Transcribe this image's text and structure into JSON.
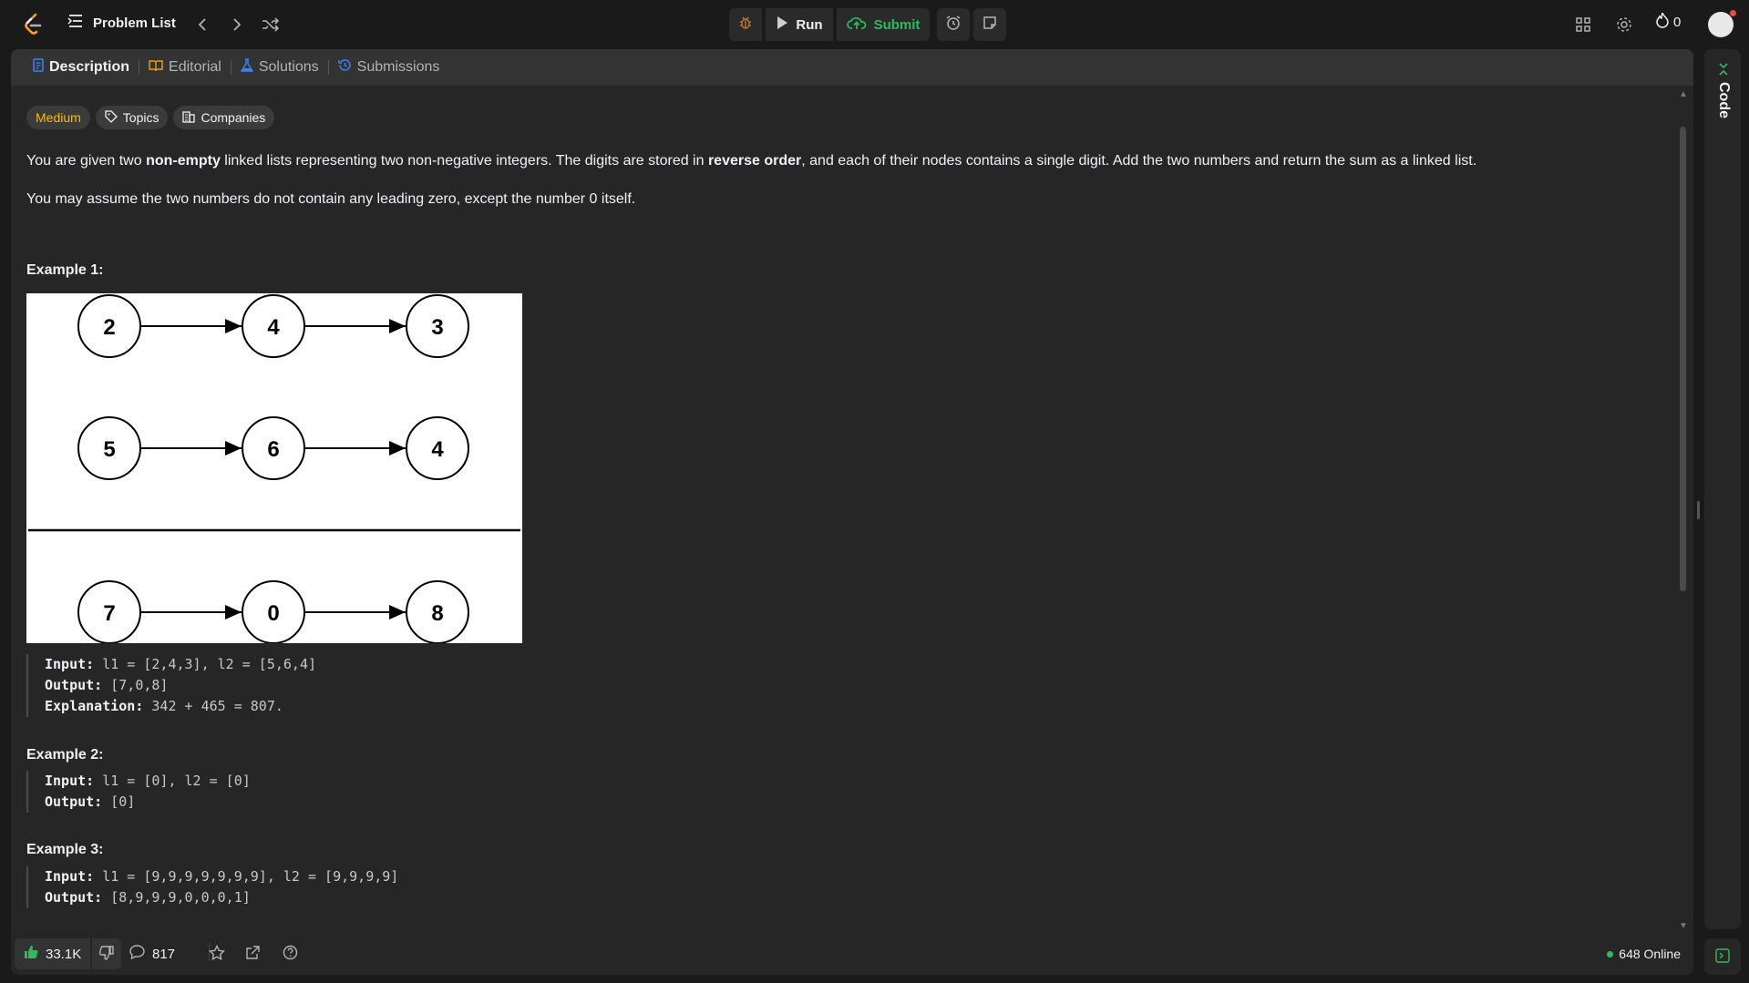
{
  "header": {
    "problem_list_label": "Problem List",
    "run_label": "Run",
    "submit_label": "Submit",
    "streak_count": "0"
  },
  "tabs": [
    {
      "label": "Description",
      "icon": "description-icon",
      "color": "#3b82f6"
    },
    {
      "label": "Editorial",
      "icon": "book-icon",
      "color": "#f59e0b"
    },
    {
      "label": "Solutions",
      "icon": "flask-icon",
      "color": "#3b82f6"
    },
    {
      "label": "Submissions",
      "icon": "history-icon",
      "color": "#3b82f6"
    }
  ],
  "tags": {
    "difficulty": "Medium",
    "topics": "Topics",
    "companies": "Companies"
  },
  "description": {
    "p1_a": "You are given two ",
    "p1_b": "non-empty",
    "p1_c": " linked lists representing two non-negative integers. The digits are stored in ",
    "p1_d": "reverse order",
    "p1_e": ", and each of their nodes contains a single digit. Add the two numbers and return the sum as a linked list.",
    "p2": "You may assume the two numbers do not contain any leading zero, except the number 0 itself."
  },
  "diagram": {
    "row1": [
      "2",
      "4",
      "3"
    ],
    "row2": [
      "5",
      "6",
      "4"
    ],
    "row3": [
      "7",
      "0",
      "8"
    ]
  },
  "examples": [
    {
      "title": "Example 1:",
      "lines": [
        {
          "key": "Input:",
          "value": " l1 = [2,4,3], l2 = [5,6,4]"
        },
        {
          "key": "Output:",
          "value": " [7,0,8]"
        },
        {
          "key": "Explanation:",
          "value": " 342 + 465 = 807."
        }
      ]
    },
    {
      "title": "Example 2:",
      "lines": [
        {
          "key": "Input:",
          "value": " l1 = [0], l2 = [0]"
        },
        {
          "key": "Output:",
          "value": " [0]"
        }
      ]
    },
    {
      "title": "Example 3:",
      "lines": [
        {
          "key": "Input:",
          "value": " l1 = [9,9,9,9,9,9,9], l2 = [9,9,9,9]"
        },
        {
          "key": "Output:",
          "value": " [8,9,9,9,0,0,0,1]"
        }
      ]
    }
  ],
  "footer": {
    "likes": "33.1K",
    "comments": "817",
    "online": "648 Online"
  },
  "side_panel": {
    "code_label": "Code"
  },
  "colors": {
    "accent_green": "#2cbb5d",
    "medium": "#ffb800",
    "debug_icon": "#b87333"
  }
}
